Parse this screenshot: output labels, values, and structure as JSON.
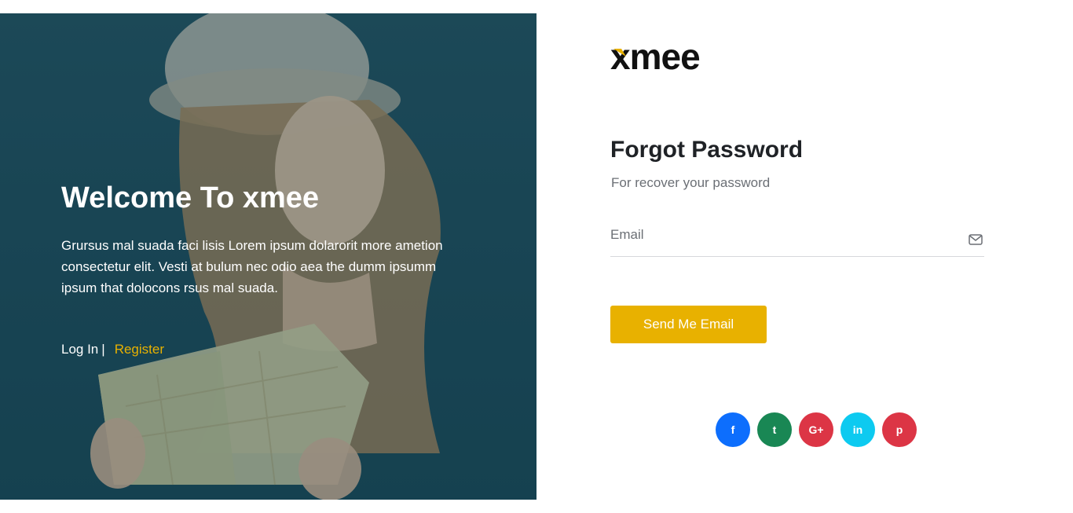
{
  "hero": {
    "title": "Welcome To xmee",
    "description": "Grursus mal suada faci lisis Lorem ipsum dolarorit more ametion consectetur elit. Vesti at bulum nec odio aea the dumm ipsumm ipsum that dolocons rsus mal suada.",
    "login_label": "Log In",
    "separator": "|",
    "register_label": "Register"
  },
  "brand": {
    "logo_text": "xmee",
    "accent": "#e8b100"
  },
  "form": {
    "title": "Forgot Password",
    "subtitle": "For recover your password",
    "email_placeholder": "Email",
    "email_icon": "envelope-icon",
    "submit_label": "Send Me Email"
  },
  "socials": [
    {
      "name": "facebook",
      "icon": "facebook-icon",
      "glyph": "f",
      "color": "#0d6efd"
    },
    {
      "name": "twitter",
      "icon": "twitter-icon",
      "glyph": "t",
      "color": "#198754"
    },
    {
      "name": "google-plus",
      "icon": "google-plus-icon",
      "glyph": "G+",
      "color": "#dc3545"
    },
    {
      "name": "linkedin",
      "icon": "linkedin-icon",
      "glyph": "in",
      "color": "#0dcaf0"
    },
    {
      "name": "pinterest",
      "icon": "pinterest-icon",
      "glyph": "p",
      "color": "#dc3545"
    }
  ]
}
